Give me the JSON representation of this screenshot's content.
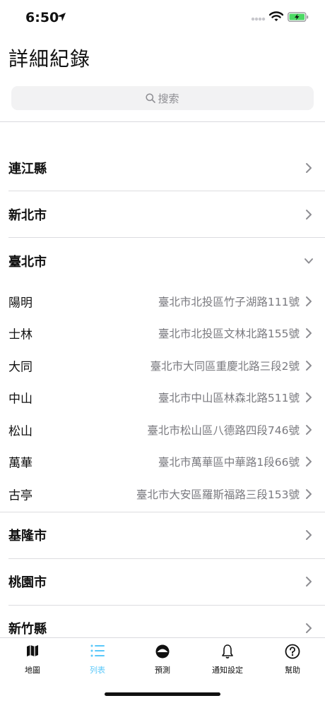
{
  "status": {
    "time": "6:50"
  },
  "title": "詳細紀錄",
  "search": {
    "placeholder": "搜索"
  },
  "regions_top": [
    {
      "label": "連江縣"
    },
    {
      "label": "新北市"
    }
  ],
  "expanded_region": {
    "label": "臺北市",
    "stations": [
      {
        "name": "陽明",
        "address": "臺北市北投區竹子湖路111號"
      },
      {
        "name": "士林",
        "address": "臺北市北投區文林北路155號"
      },
      {
        "name": "大同",
        "address": "臺北市大同區重慶北路三段2號"
      },
      {
        "name": "中山",
        "address": "臺北市中山區林森北路511號"
      },
      {
        "name": "松山",
        "address": "臺北市松山區八德路四段746號"
      },
      {
        "name": "萬華",
        "address": "臺北市萬華區中華路1段66號"
      },
      {
        "name": "古亭",
        "address": "臺北市大安區羅斯福路三段153號"
      }
    ]
  },
  "regions_bottom": [
    {
      "label": "基隆市"
    },
    {
      "label": "桃園市"
    },
    {
      "label": "新竹縣"
    }
  ],
  "tabs": [
    {
      "label": "地圖",
      "icon": "map-icon"
    },
    {
      "label": "列表",
      "icon": "list-icon",
      "active": true
    },
    {
      "label": "預測",
      "icon": "forecast-icon"
    },
    {
      "label": "通知設定",
      "icon": "bell-icon"
    },
    {
      "label": "幫助",
      "icon": "help-icon"
    }
  ],
  "colors": {
    "accent": "#5ac8fa",
    "battery": "#4cd964"
  }
}
